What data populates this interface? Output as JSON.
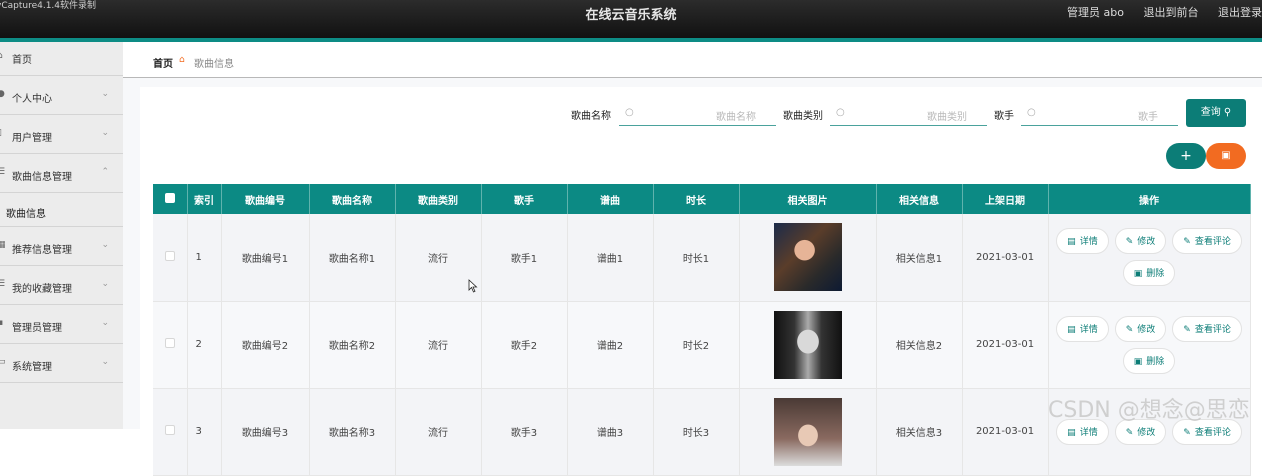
{
  "window": {
    "capture_watermark": "vCapture4.1.4软件录制",
    "app_title": "在线云音乐系统"
  },
  "header_links": {
    "admin": "管理员 abo",
    "front": "退出到前台",
    "logout": "退出登录"
  },
  "sidebar": {
    "home": "首页",
    "items": [
      {
        "label": "个人中心"
      },
      {
        "label": "用户管理"
      },
      {
        "label": "歌曲信息管理"
      },
      {
        "label": "推荐信息管理"
      },
      {
        "label": "我的收藏管理"
      },
      {
        "label": "管理员管理"
      },
      {
        "label": "系统管理"
      }
    ],
    "sub_item": "歌曲信息"
  },
  "breadcrumb": {
    "home": "首页",
    "current": "歌曲信息"
  },
  "search": {
    "name_label": "歌曲名称",
    "name_placeholder": "歌曲名称",
    "type_label": "歌曲类别",
    "type_placeholder": "歌曲类别",
    "singer_label": "歌手",
    "singer_placeholder": "歌手",
    "query_button": "查询"
  },
  "actions": {
    "add": "+",
    "delete": "删除"
  },
  "table": {
    "headers": [
      "索引",
      "歌曲编号",
      "歌曲名称",
      "歌曲类别",
      "歌手",
      "谱曲",
      "时长",
      "相关图片",
      "相关信息",
      "上架日期",
      "操作"
    ],
    "rows": [
      {
        "index": "1",
        "code": "歌曲编号1",
        "name": "歌曲名称1",
        "type": "流行",
        "singer": "歌手1",
        "composer": "谱曲1",
        "duration": "时长1",
        "info": "相关信息1",
        "date": "2021-03-01"
      },
      {
        "index": "2",
        "code": "歌曲编号2",
        "name": "歌曲名称2",
        "type": "流行",
        "singer": "歌手2",
        "composer": "谱曲2",
        "duration": "时长2",
        "info": "相关信息2",
        "date": "2021-03-01"
      },
      {
        "index": "3",
        "code": "歌曲编号3",
        "name": "歌曲名称3",
        "type": "流行",
        "singer": "歌手3",
        "composer": "谱曲3",
        "duration": "时长3",
        "info": "相关信息3",
        "date": "2021-03-01"
      }
    ],
    "ops": {
      "detail": "详情",
      "edit": "修改",
      "comments": "查看评论",
      "delete": "删除"
    }
  },
  "overlay": {
    "csdn": "CSDN @想念@思恋"
  },
  "colors": {
    "primary": "#0c8a84",
    "accent": "#f26b21",
    "header_bg": "#1a1a1a"
  }
}
